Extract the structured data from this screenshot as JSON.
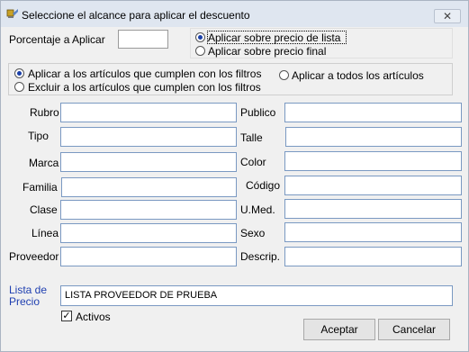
{
  "window": {
    "title": "Seleccione el alcance para aplicar el descuento",
    "close_glyph": "✕"
  },
  "porcentaje": {
    "label": "Porcentaje a Aplicar",
    "value": ""
  },
  "precio_options": [
    {
      "label": "Aplicar sobre precio de lista",
      "selected": true
    },
    {
      "label": "Aplicar sobre precio final",
      "selected": false
    }
  ],
  "scope_options": {
    "cumplen": "Aplicar a los artículos que cumplen con los filtros",
    "todos": "Aplicar a todos los artículos",
    "excluir": "Excluir a los artículos que cumplen con los filtros"
  },
  "filters": {
    "rubro": "Rubro",
    "tipo": "Tipo",
    "marca": "Marca",
    "familia": "Familia",
    "clase": "Clase",
    "linea": "Línea",
    "proveedor": "Proveedor",
    "publico": "Publico",
    "talle": "Talle",
    "color": "Color",
    "codigo": "Código",
    "umed": "U.Med.",
    "sexo": "Sexo",
    "descrip": "Descrip."
  },
  "lista": {
    "label_line1": "Lista de",
    "label_line2": "Precio",
    "value": "LISTA PROVEEDOR DE PRUEBA"
  },
  "activos": {
    "label": "Activos",
    "checked": true
  },
  "buttons": {
    "aceptar": "Aceptar",
    "cancelar": "Cancelar"
  }
}
